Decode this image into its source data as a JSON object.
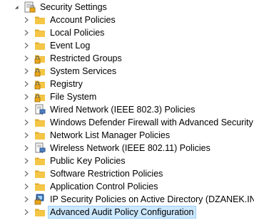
{
  "root": {
    "label": "Security Settings",
    "expanded": true,
    "icon": "security-settings-icon"
  },
  "items": [
    {
      "label": "Account Policies",
      "icon": "folder-icon"
    },
    {
      "label": "Local Policies",
      "icon": "folder-icon"
    },
    {
      "label": "Event Log",
      "icon": "folder-icon"
    },
    {
      "label": "Restricted Groups",
      "icon": "locked-folder-icon"
    },
    {
      "label": "System Services",
      "icon": "locked-folder-icon"
    },
    {
      "label": "Registry",
      "icon": "locked-folder-icon"
    },
    {
      "label": "File System",
      "icon": "locked-folder-icon"
    },
    {
      "label": "Wired Network (IEEE 802.3) Policies",
      "icon": "network-policy-icon"
    },
    {
      "label": "Windows Defender Firewall with Advanced Security",
      "icon": "folder-icon"
    },
    {
      "label": "Network List Manager Policies",
      "icon": "folder-icon"
    },
    {
      "label": "Wireless Network (IEEE 802.11) Policies",
      "icon": "network-policy-icon"
    },
    {
      "label": "Public Key Policies",
      "icon": "folder-icon"
    },
    {
      "label": "Software Restriction Policies",
      "icon": "folder-icon"
    },
    {
      "label": "Application Control Policies",
      "icon": "folder-icon"
    },
    {
      "label": "IP Security Policies on Active Directory (DZANEK.INT)",
      "icon": "ip-security-icon"
    },
    {
      "label": "Advanced Audit Policy Configuration",
      "icon": "folder-icon",
      "selected": true
    }
  ],
  "colors": {
    "folder": "#f5c646",
    "folder_dark": "#dca82a",
    "lock": "#e7a51c",
    "chevron": "#6d6d6d",
    "selection": "#cce8ff",
    "selection_border": "#99d1ff"
  }
}
